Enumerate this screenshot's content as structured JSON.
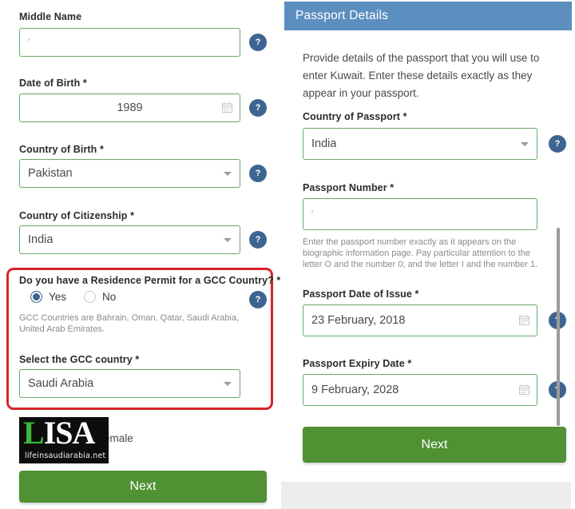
{
  "left_form": {
    "fields": [
      {
        "label": "Middle Name",
        "value": "'",
        "type": "text"
      },
      {
        "label": "Date of Birth *",
        "value": "1989",
        "type": "date"
      },
      {
        "label": "Country of Birth *",
        "value": "Pakistan",
        "type": "select"
      },
      {
        "label": "Country of Citizenship *",
        "value": "India",
        "type": "select"
      }
    ],
    "gcc": {
      "question": "Do you have a Residence Permit for a GCC Country? *",
      "options": [
        {
          "label": "Yes",
          "checked": true
        },
        {
          "label": "No",
          "checked": false
        }
      ],
      "hint": "GCC Countries are Bahrain, Oman, Qatar, Saudi Arabia, United Arab Emirates.",
      "select_label": "Select the GCC country *",
      "select_value": "Saudi Arabia"
    },
    "gender_remnant": "emale",
    "next_label": "Next",
    "help_symbol": "?"
  },
  "watermark": {
    "brand_l": "L",
    "brand_isa": "ISA",
    "url": "lifeinsaudiarabia.net"
  },
  "passport": {
    "header_title": "Passport Details",
    "intro": "Provide details of the passport that you will use to enter Kuwait. Enter these details exactly as they appear in your passport.",
    "country_label": "Country of Passport *",
    "country_value": "India",
    "number_label": "Passport Number *",
    "number_value": "'",
    "number_hint": "Enter the passport number exactly as it appears on the biographic information page. Pay particular attention to the letter O and the number 0; and the letter I and the number 1.",
    "issue_label": "Passport Date of Issue *",
    "issue_value": "23 February, 2018",
    "expiry_label": "Passport Expiry Date *",
    "expiry_value": "9 February, 2028",
    "next_label": "Next",
    "help_symbol": "?"
  },
  "colors": {
    "header_blue": "#5c8fc0",
    "help_blue": "#3d6591",
    "input_green": "#6aab6a",
    "button_green": "#4f9133",
    "highlight_red": "#d8232a",
    "footer_grey": "#ededed"
  }
}
